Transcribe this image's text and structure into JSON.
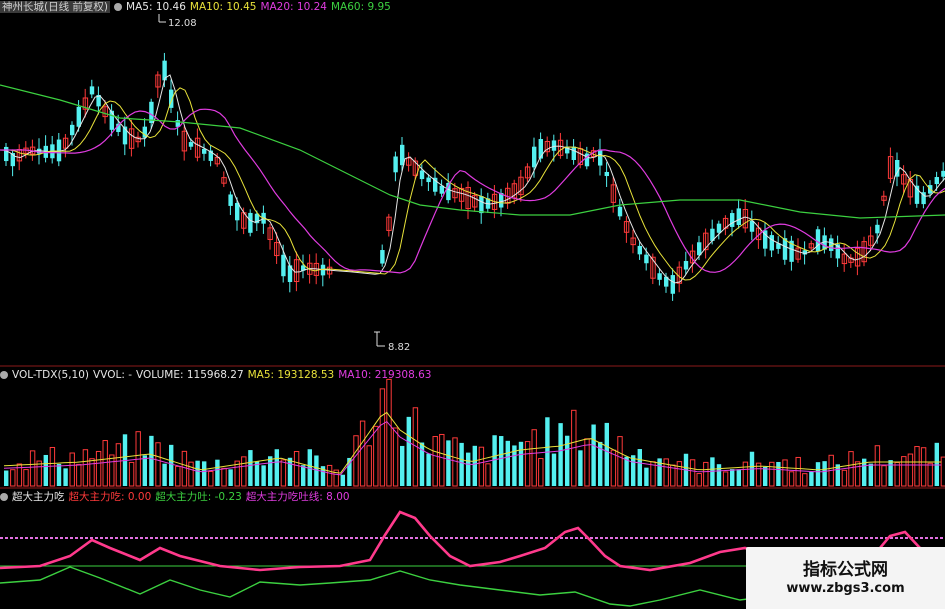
{
  "main_header": {
    "stock": "神州长城(日线 前复权)",
    "ma5": "MA5: 10.46",
    "ma10": "MA10: 10.45",
    "ma20": "MA20: 10.24",
    "ma60": "MA60: 9.95",
    "high_label": "12.08",
    "low_label": "8.82"
  },
  "volume_header": {
    "name": "VOL-TDX(5,10)",
    "vvol": "VVOL: -",
    "volume": "VOLUME: 115968.27",
    "ma5": "MA5: 193128.53",
    "ma10": "MA10: 219308.63"
  },
  "indicator_header": {
    "name": "超大主力吃",
    "eat": "超大主力吃: 0.00",
    "spit": "超大主力吐: -0.23",
    "line": "超大主力吃吐线: 8.00"
  },
  "watermark": {
    "title": "指标公式网",
    "url": "www.zbgs3.com"
  },
  "colors": {
    "up": "#ff3a3a",
    "down": "#54f0f0",
    "ma5": "#e6e6e6",
    "ma10": "#e8e23a",
    "ma20": "#e03ce0",
    "ma60": "#3cd040",
    "divider": "#8b1a1a"
  },
  "chart_data": [
    {
      "type": "candlestick",
      "title": "神州长城(日线 前复权)",
      "annotations": [
        {
          "label": "12.08",
          "kind": "high"
        },
        {
          "label": "8.82",
          "kind": "low"
        }
      ],
      "series": [
        {
          "name": "MA5",
          "value": 10.46
        },
        {
          "name": "MA10",
          "value": 10.45
        },
        {
          "name": "MA20",
          "value": 10.24
        },
        {
          "name": "MA60",
          "value": 9.95
        }
      ]
    },
    {
      "type": "bar",
      "title": "VOL-TDX(5,10)",
      "series": [
        {
          "name": "VOLUME",
          "value": 115968.27
        },
        {
          "name": "MA5",
          "value": 193128.53
        },
        {
          "name": "MA10",
          "value": 219308.63
        }
      ]
    },
    {
      "type": "line",
      "title": "超大主力吃",
      "series": [
        {
          "name": "超大主力吃",
          "value": 0.0
        },
        {
          "name": "超大主力吐",
          "value": -0.23
        },
        {
          "name": "超大主力吃吐线",
          "value": 8.0
        }
      ]
    }
  ]
}
